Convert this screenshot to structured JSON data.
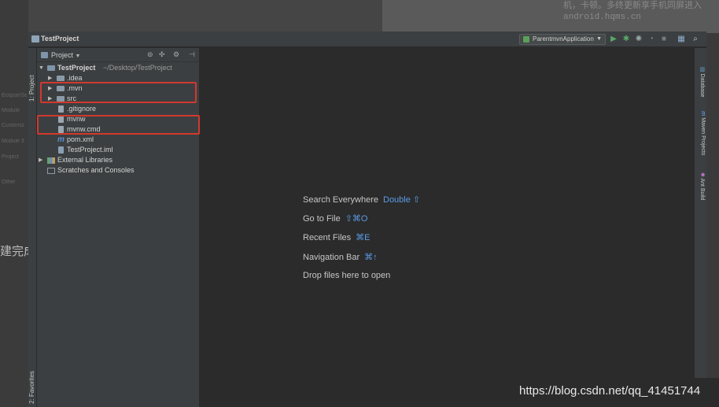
{
  "background": {
    "top_text": "机，卡顿。多终更新享手机同屏进入",
    "top_url": "android.hqms.cn",
    "side_labels": [
      "Eclipse/Sett",
      "Module",
      "Customiz",
      "Module 3",
      "Project",
      "Other"
    ],
    "big_text": "建完成"
  },
  "window": {
    "title": "TestProject",
    "run_config": "ParentmvnApplication"
  },
  "left_tabs": {
    "project": "1: Project",
    "favorites": "2: Favorites"
  },
  "right_tabs": {
    "database": "Database",
    "maven": "Maven Projects",
    "ant": "Ant Build"
  },
  "project_panel": {
    "title": "Project",
    "tree": [
      {
        "label": "TestProject",
        "sub": "~/Desktop/TestProject",
        "type": "project",
        "expanded": true,
        "level": 0
      },
      {
        "label": ".idea",
        "type": "folder",
        "expanded": false,
        "level": 1
      },
      {
        "label": ".mvn",
        "type": "folder",
        "expanded": false,
        "level": 1
      },
      {
        "label": "src",
        "type": "folder",
        "expanded": false,
        "level": 1
      },
      {
        "label": ".gitignore",
        "type": "file",
        "level": 1
      },
      {
        "label": "mvnw",
        "type": "file",
        "level": 1
      },
      {
        "label": "mvnw.cmd",
        "type": "file",
        "level": 1
      },
      {
        "label": "pom.xml",
        "type": "maven",
        "level": 1
      },
      {
        "label": "TestProject.iml",
        "type": "file",
        "level": 1
      },
      {
        "label": "External Libraries",
        "type": "library",
        "expanded": false,
        "level": 0
      },
      {
        "label": "Scratches and Consoles",
        "type": "scratch",
        "level": 0
      }
    ]
  },
  "editor_hints": [
    {
      "text": "Search Everywhere",
      "key": "Double ⇧"
    },
    {
      "text": "Go to File",
      "key": "⇧⌘O"
    },
    {
      "text": "Recent Files",
      "key": "⌘E"
    },
    {
      "text": "Navigation Bar",
      "key": "⌘↑"
    },
    {
      "text": "Drop files here to open",
      "key": ""
    }
  ],
  "watermark": "https://blog.csdn.net/qq_41451744",
  "colors": {
    "accent_key": "#5b9be6",
    "highlight_box": "#d0392e",
    "run_green": "#59a869"
  }
}
